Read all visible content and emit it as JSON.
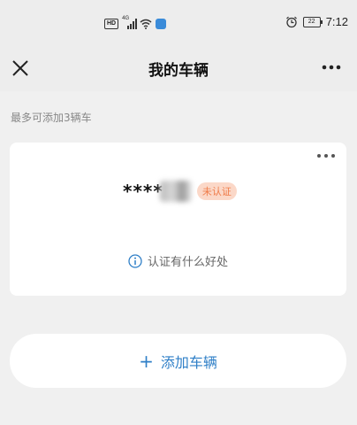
{
  "status_bar": {
    "hd_badge": "HD",
    "signal_label": "4G",
    "battery_level": "22",
    "time": "7:12"
  },
  "navbar": {
    "title": "我的车辆",
    "close_icon": "close-icon",
    "more_icon": "more-icon"
  },
  "hint": "最多可添加3辆车",
  "vehicle_card": {
    "plate": "****",
    "status_badge": "未认证",
    "info_link": "认证有什么好处",
    "more_icon": "more-icon",
    "info_icon": "info-icon"
  },
  "add_button": {
    "plus": "+",
    "label": "添加车辆"
  },
  "colors": {
    "accent": "#2f7fc7",
    "badge_bg": "#fbd8c8",
    "badge_text": "#ef7b48",
    "page_bg": "#f0f0f0"
  }
}
